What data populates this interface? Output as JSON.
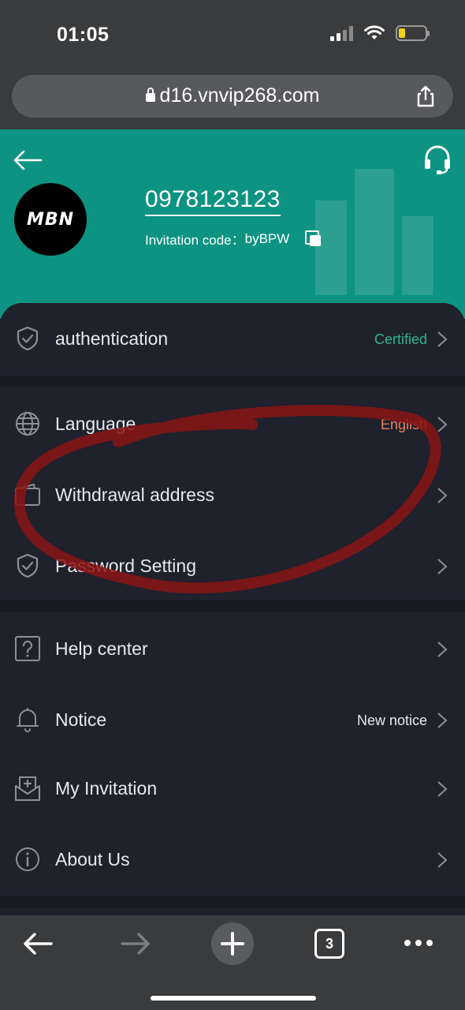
{
  "status_bar": {
    "time": "01:05"
  },
  "browser": {
    "url": "d16.vnvip268.com",
    "tab_count": "3"
  },
  "profile": {
    "phone": "0978123123",
    "invitation_label": "Invitation code：",
    "invitation_code": "byBPW",
    "avatar_text": "MBN"
  },
  "menu": {
    "authentication": {
      "label": "authentication",
      "value": "Certified"
    },
    "language": {
      "label": "Language",
      "value": "English"
    },
    "withdrawal": {
      "label": "Withdrawal address"
    },
    "password": {
      "label": "Password Setting"
    },
    "help": {
      "label": "Help center"
    },
    "notice": {
      "label": "Notice",
      "value": "New notice"
    },
    "invitation": {
      "label": "My Invitation"
    },
    "about": {
      "label": "About Us"
    }
  },
  "colors": {
    "header_teal": "#0d9381",
    "card_bg": "#1f212d",
    "certified_green": "#2fb38b",
    "english_orange": "#f07f5c",
    "annotation_red": "#8a1414"
  },
  "icons": {
    "back": "arrow-left-icon",
    "support": "headset-icon",
    "copy": "copy-icon",
    "authentication": "shield-check-icon",
    "language": "globe-icon",
    "withdrawal": "wallet-icon",
    "password": "shield-check-icon",
    "help": "question-box-icon",
    "notice": "bell-icon",
    "invitation": "invite-box-icon",
    "about": "info-circle-icon"
  }
}
